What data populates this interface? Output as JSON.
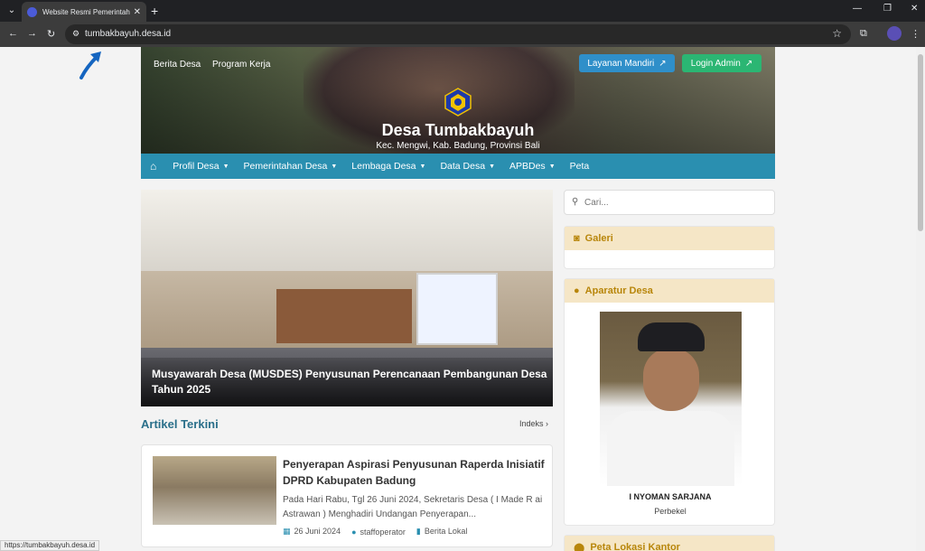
{
  "browser": {
    "tab_title": "Website Resmi Pemerintah Desa",
    "url": "tumbakbayuh.desa.id",
    "status_url": "https://tumbakbayuh.desa.id"
  },
  "header": {
    "top_links": [
      "Berita Desa",
      "Program Kerja"
    ],
    "layanan_label": "Layanan Mandiri",
    "login_label": "Login Admin",
    "site_title": "Desa Tumbakbayuh",
    "site_subtitle": "Kec. Mengwi, Kab. Badung, Provinsi Bali"
  },
  "nav": {
    "items": [
      {
        "label": "Profil Desa",
        "dropdown": true
      },
      {
        "label": "Pemerintahan Desa",
        "dropdown": true
      },
      {
        "label": "Lembaga Desa",
        "dropdown": true
      },
      {
        "label": "Data Desa",
        "dropdown": true
      },
      {
        "label": "APBDes",
        "dropdown": true
      },
      {
        "label": "Peta",
        "dropdown": false
      }
    ]
  },
  "hero": {
    "caption": "Musyawarah Desa (MUSDES) Penyusunan Perencanaan Pembangunan Desa Tahun 2025"
  },
  "artikel": {
    "section_title": "Artikel Terkini",
    "indeks_label": "Indeks",
    "items": [
      {
        "title": "Penyerapan Aspirasi Penyusunan Raperda Inisiatif DPRD Kabupaten Badung",
        "excerpt": "Pada Hari Rabu, Tgl 26 Juni 2024, Sekretaris Desa ( I Made R ai Astrawan ) Menghadiri Undangan Penyerapan...",
        "date": "26 Juni 2024",
        "author": "staffoperator",
        "category": "Berita Lokal"
      }
    ]
  },
  "sidebar": {
    "search_placeholder": "Cari...",
    "galeri_title": "Galeri",
    "aparatur_title": "Aparatur Desa",
    "aparatur_name": "I NYOMAN SARJANA",
    "aparatur_role": "Perbekel",
    "peta_title": "Peta Lokasi Kantor"
  },
  "colors": {
    "nav_bg": "#2a8fb0",
    "layanan_btn": "#2f8fc9",
    "login_btn": "#2bb673",
    "widget_header_bg": "#f5e6c6",
    "widget_header_text": "#b8860b"
  }
}
